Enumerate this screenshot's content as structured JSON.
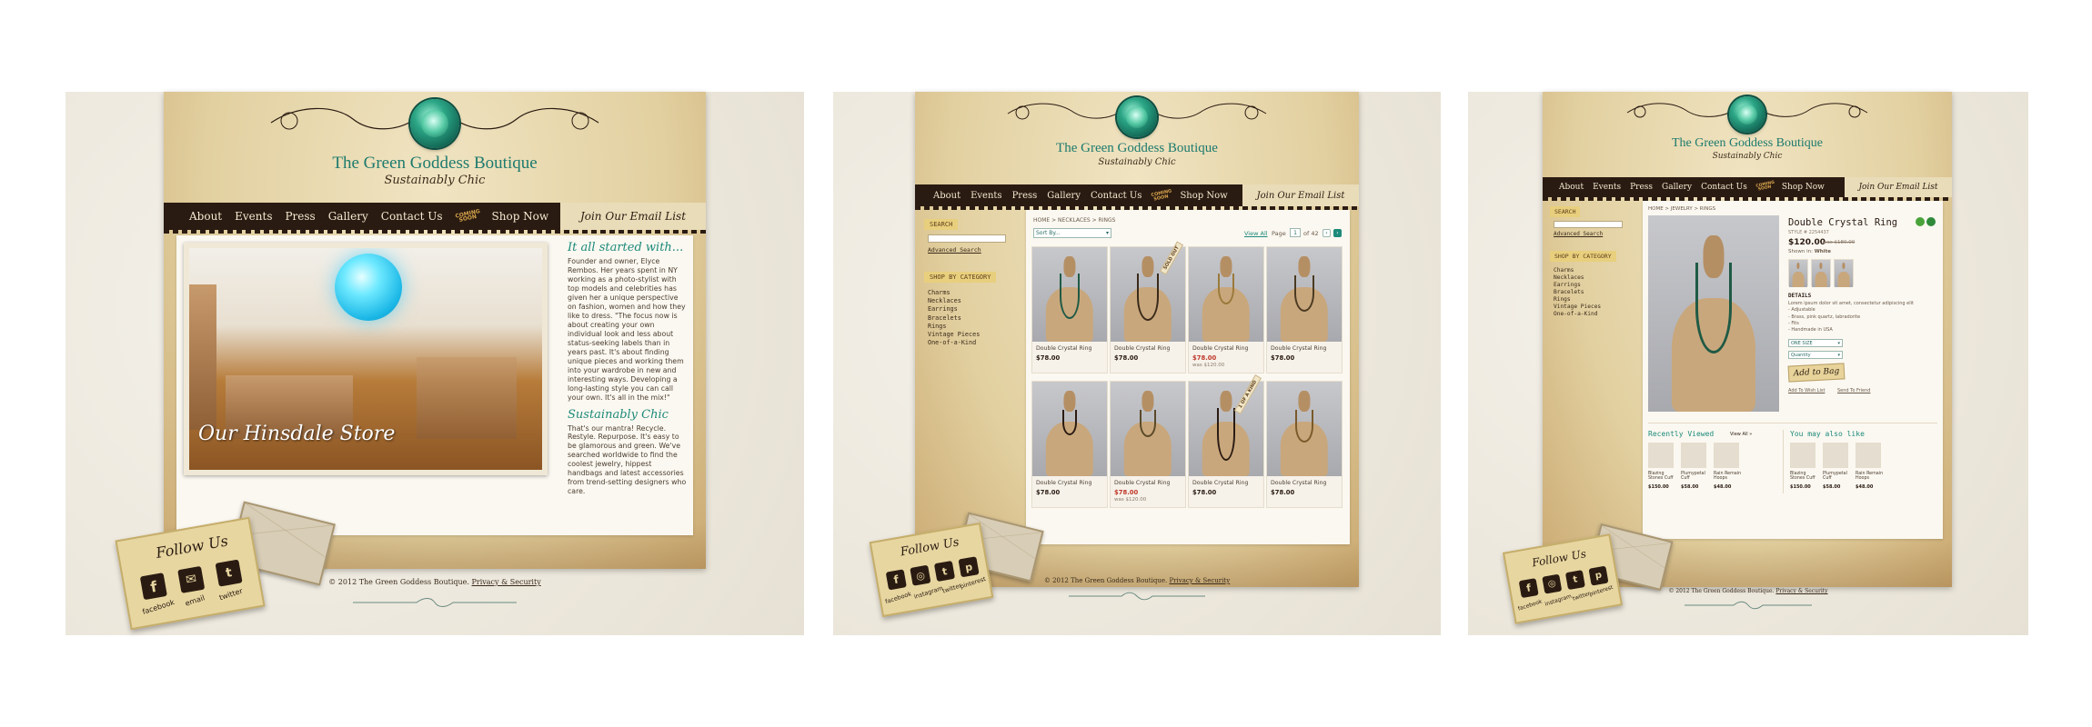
{
  "brand": {
    "name": "The Green Goddess Boutique",
    "tagline": "Sustainably Chic"
  },
  "nav": {
    "items": [
      "About",
      "Events",
      "Press",
      "Gallery",
      "Contact Us",
      "Shop Now"
    ],
    "coming_soon": "COMING SOON",
    "email_list": "Join Our Email List"
  },
  "follow": {
    "title": "Follow Us",
    "labels": [
      "facebook",
      "email",
      "twitter"
    ],
    "labels_alt": [
      "facebook",
      "instagram",
      "twitter",
      "pinterest"
    ]
  },
  "footer": {
    "copyright": "© 2012 The Green Goddess Boutique.",
    "privacy": "Privacy & Security"
  },
  "home": {
    "photo_caption": "Our Hinsdale Store",
    "intro_heading": "It all started with...",
    "intro_text": "Founder and owner, Elyce Rembos. Her years spent in NY working as a photo-stylist with top models and celebrities has given her a unique perspective on fashion, women and how they like to dress. \"The focus now is about creating your own individual look and less about status-seeking labels than in years past. It's about finding unique pieces and working them into your wardrobe in new and interesting ways. Developing a long-lasting style you can call your own. It's all in the mix!\"",
    "chic_heading": "Sustainably Chic",
    "chic_text": "That's our mantra! Recycle. Restyle. Repurpose. It's easy to be glamorous and green. We've searched worldwide to find the coolest jewelry, hippest handbags and latest accessories from trend-setting designers who care."
  },
  "shop": {
    "search_label": "SEARCH",
    "advanced_search": "Advanced Search",
    "category_label": "SHOP BY CATEGORY",
    "categories": [
      "Charms",
      "Necklaces",
      "Earrings",
      "Bracelets",
      "Rings",
      "Vintage Pieces",
      "One-of-a-Kind"
    ],
    "breadcrumb": "HOME  >  NECKLACES  >  RINGS",
    "sort_by": "Sort By...",
    "view_all": "View All",
    "page_label": "Page",
    "page_num": "1",
    "page_of": "of 42",
    "products": [
      {
        "name": "Double Crystal Ring",
        "price": "$78.00",
        "sale": false,
        "was": "",
        "ribbon": ""
      },
      {
        "name": "Double Crystal Ring",
        "price": "$78.00",
        "sale": false,
        "was": "",
        "ribbon": "SOLD OUT"
      },
      {
        "name": "Double Crystal Ring",
        "price": "$78.00",
        "sale": true,
        "was": "was $120.00",
        "ribbon": ""
      },
      {
        "name": "Double Crystal Ring",
        "price": "$78.00",
        "sale": false,
        "was": "",
        "ribbon": ""
      },
      {
        "name": "Double Crystal Ring",
        "price": "$78.00",
        "sale": false,
        "was": "",
        "ribbon": ""
      },
      {
        "name": "Double Crystal Ring",
        "price": "$78.00",
        "sale": true,
        "was": "was $120.00",
        "ribbon": ""
      },
      {
        "name": "Double Crystal Ring",
        "price": "$78.00",
        "sale": false,
        "was": "",
        "ribbon": "1 OF A KIND"
      },
      {
        "name": "Double Crystal Ring",
        "price": "$78.00",
        "sale": false,
        "was": "",
        "ribbon": ""
      }
    ]
  },
  "product": {
    "breadcrumb": "HOME  >  JEWELRY  >  RINGS",
    "title": "Double Crystal Ring",
    "style": "STYLE # 2254437",
    "price": "$120.00",
    "was": "was $180.00",
    "shown_label": "Shown in:",
    "shown_value": "White",
    "details_label": "DETAILS",
    "details": [
      "Lorem ipsum dolor sit amet, consectetur adipiscing elit",
      "- Adjustable",
      "- Brass, pink quartz, labradorite",
      "- Fits",
      "- Handmade in USA"
    ],
    "size_select": "ONE SIZE",
    "qty_select": "Quantity",
    "add_to_bag": "Add to Bag",
    "add_wish": "Add To Wish List",
    "send_friend": "Send To Friend",
    "recent_label": "Recently Viewed",
    "recent_link": "View All »",
    "also_label": "You may also like",
    "recent_items": [
      {
        "name": "Blazing Stones Cuff",
        "price": "$150.00"
      },
      {
        "name": "Plumypetal Cuff",
        "price": "$58.00"
      },
      {
        "name": "Rain Remain Hoops",
        "price": "$48.00"
      }
    ],
    "also_items": [
      {
        "name": "Blazing Stones Cuff",
        "price": "$150.00"
      },
      {
        "name": "Plumypetal Cuff",
        "price": "$58.00"
      },
      {
        "name": "Rain Remain Hoops",
        "price": "$48.00"
      }
    ]
  },
  "colors": {
    "brand_teal": "#1d7a6e",
    "nav_dark": "#2a1b12",
    "parchment": "#e3d3a9",
    "sale_red": "#c0392b"
  }
}
